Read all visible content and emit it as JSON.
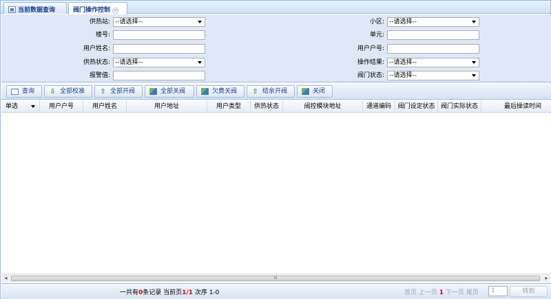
{
  "tabs": [
    {
      "label": "当前数据查询",
      "icon": "image-icon"
    },
    {
      "label": "阀门操作控制",
      "icon": "close-icon"
    }
  ],
  "filters": {
    "station_label": "供热站:",
    "station_value": "--请选择--",
    "building_label": "楼号:",
    "building_value": "",
    "username_label": "用户姓名:",
    "username_value": "",
    "heatstatus_label": "供热状态:",
    "heatstatus_value": "--请选择--",
    "alarm_label": "报警值:",
    "alarm_value": "",
    "community_label": "小区:",
    "community_value": "--请选择--",
    "unit_label": "单元:",
    "unit_value": "",
    "account_label": "用户户号:",
    "account_value": "",
    "result_label": "操作结果:",
    "result_value": "--请选择--",
    "valve_label": "阀门状态:",
    "valve_value": "--请选择--"
  },
  "toolbar": {
    "query": "查询",
    "calibrate_all": "全部校准",
    "open_all": "全部开阀",
    "close_all": "全部关阀",
    "arrears_close": "欠费关阀",
    "balance_open": "结余开阀",
    "close": "关闭"
  },
  "grid": {
    "select_mode": "单选",
    "columns": [
      "用户户号",
      "用户姓名",
      "用户地址",
      "用户类型",
      "供热状态",
      "阀控模块地址",
      "通道编码",
      "阀门设定状态",
      "阀门实际状态",
      "最后操读时间"
    ]
  },
  "scrollbar": {
    "left": "◂",
    "right": "▸",
    "grip": "III"
  },
  "pager": {
    "total_prefix": "一共有",
    "total_count": "0",
    "total_suffix": "条记录  当前页",
    "current": "1/1",
    "order_text": " 次序  1-0",
    "first": "首页",
    "prev": "上一页",
    "page": "1",
    "next": "下一页",
    "last": "尾页",
    "goto_value": "1",
    "goto": "转到"
  }
}
